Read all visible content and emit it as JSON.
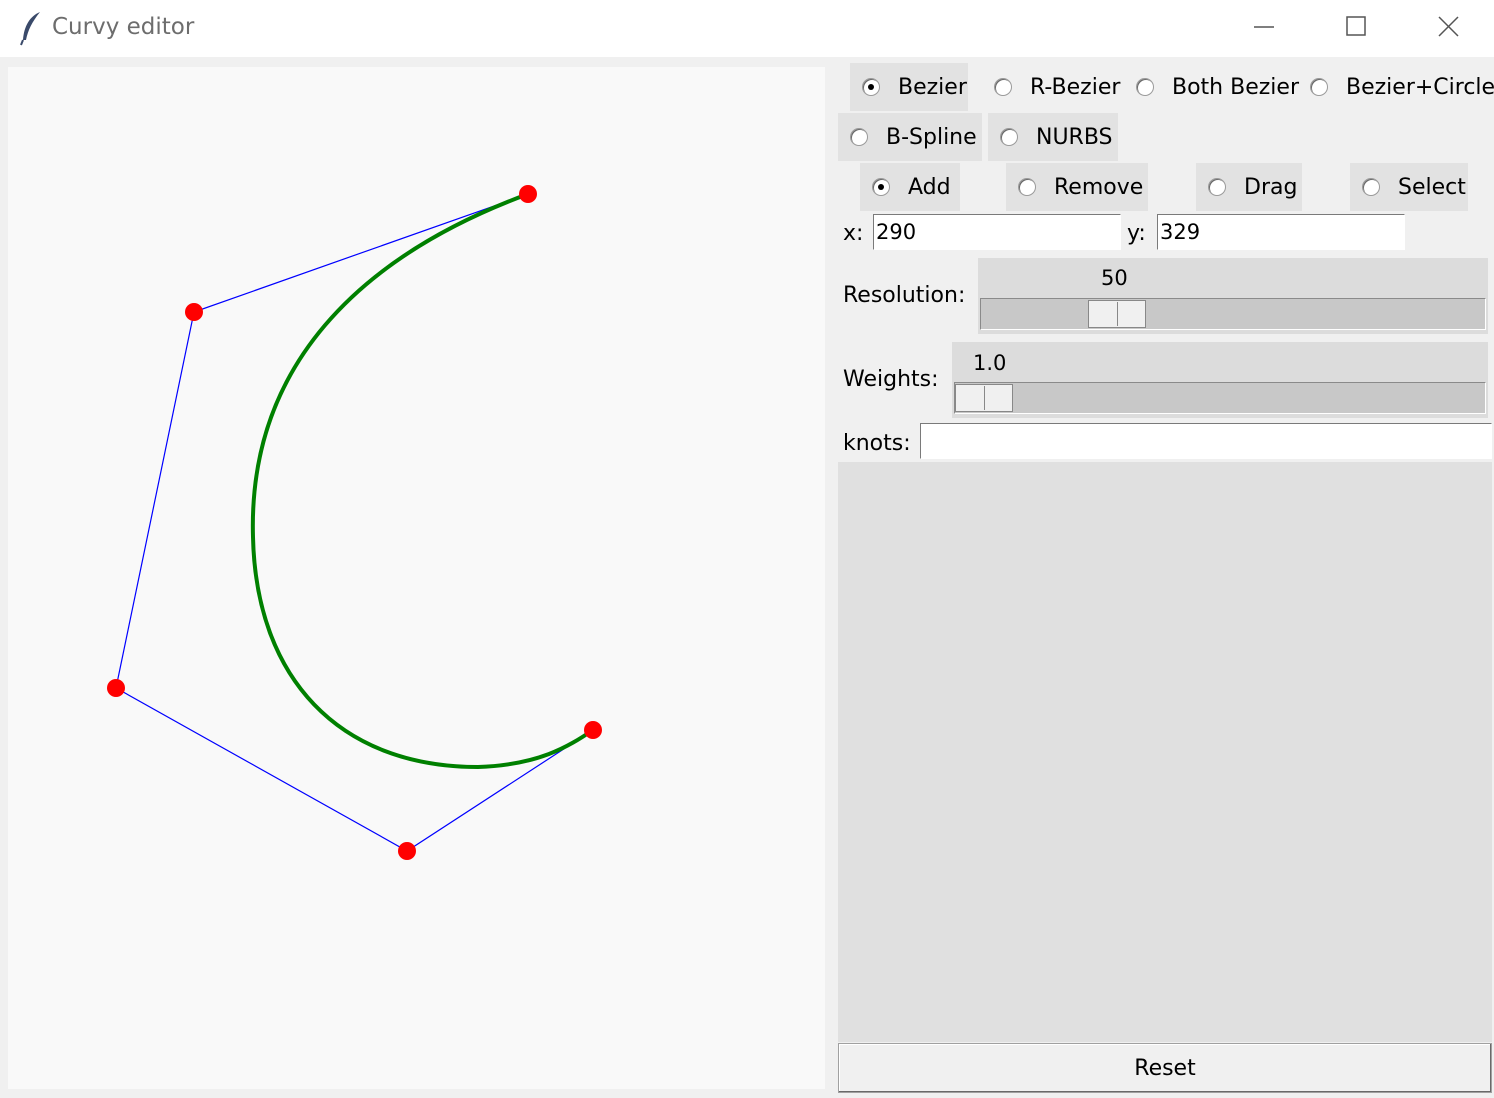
{
  "window": {
    "title": "Curvy editor",
    "app_icon": "feather-icon",
    "controls": [
      "minimize-icon",
      "maximize-icon",
      "close-icon"
    ]
  },
  "curve_types": [
    {
      "label": "Bezier",
      "selected": true
    },
    {
      "label": "R-Bezier",
      "selected": false
    },
    {
      "label": "Both Bezier",
      "selected": false
    },
    {
      "label": "Bezier+Circle",
      "selected": false
    },
    {
      "label": "B-Spline",
      "selected": false
    },
    {
      "label": "NURBS",
      "selected": false
    }
  ],
  "modes": [
    {
      "label": "Add",
      "selected": true
    },
    {
      "label": "Remove",
      "selected": false
    },
    {
      "label": "Drag",
      "selected": false
    },
    {
      "label": "Select",
      "selected": false
    }
  ],
  "coords": {
    "x_label": "x:",
    "x_value": "290",
    "y_label": "y:",
    "y_value": "329"
  },
  "resolution": {
    "label": "Resolution:",
    "value": "50",
    "fraction": 0.24
  },
  "weights": {
    "label": "Weights:",
    "value": "1.0",
    "fraction": 0.0
  },
  "knots": {
    "label": "knots:",
    "value": ""
  },
  "reset_label": "Reset",
  "colors": {
    "control_point": "#ff0000",
    "control_polygon": "#0000ff",
    "curve": "#008000",
    "canvas_bg": "#f9f9f9"
  }
}
